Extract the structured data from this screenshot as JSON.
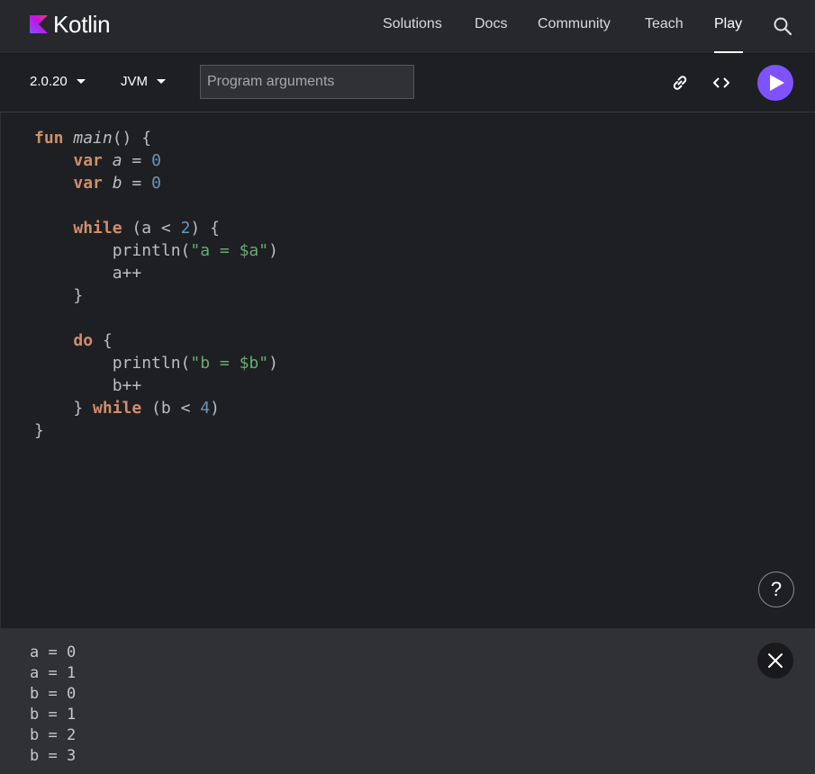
{
  "nav": {
    "logo_text": "Kotlin",
    "items": [
      "Solutions",
      "Docs",
      "Community",
      "Teach",
      "Play"
    ],
    "active": "Play"
  },
  "toolbar": {
    "version": "2.0.20",
    "target": "JVM",
    "args_placeholder": "Program arguments",
    "args_value": ""
  },
  "code_lines": [
    "fun main() {",
    "    var a = 0",
    "    var b = 0",
    "",
    "    while (a < 2) {",
    "        println(\"a = $a\")",
    "        a++",
    "    }",
    "",
    "    do {",
    "        println(\"b = $b\")",
    "        b++",
    "    } while (b < 4)",
    "}"
  ],
  "help_label": "?",
  "output_lines": [
    "a = 0",
    "a = 1",
    "b = 0",
    "b = 1",
    "b = 2",
    "b = 3"
  ],
  "colors": {
    "accent": "#7f52ff",
    "keyword": "#cf8e6d",
    "string": "#6aab73",
    "number": "#6897bb"
  },
  "icons": [
    "search-icon",
    "link-icon",
    "code-embed-icon",
    "play-icon",
    "help-icon",
    "close-icon"
  ]
}
